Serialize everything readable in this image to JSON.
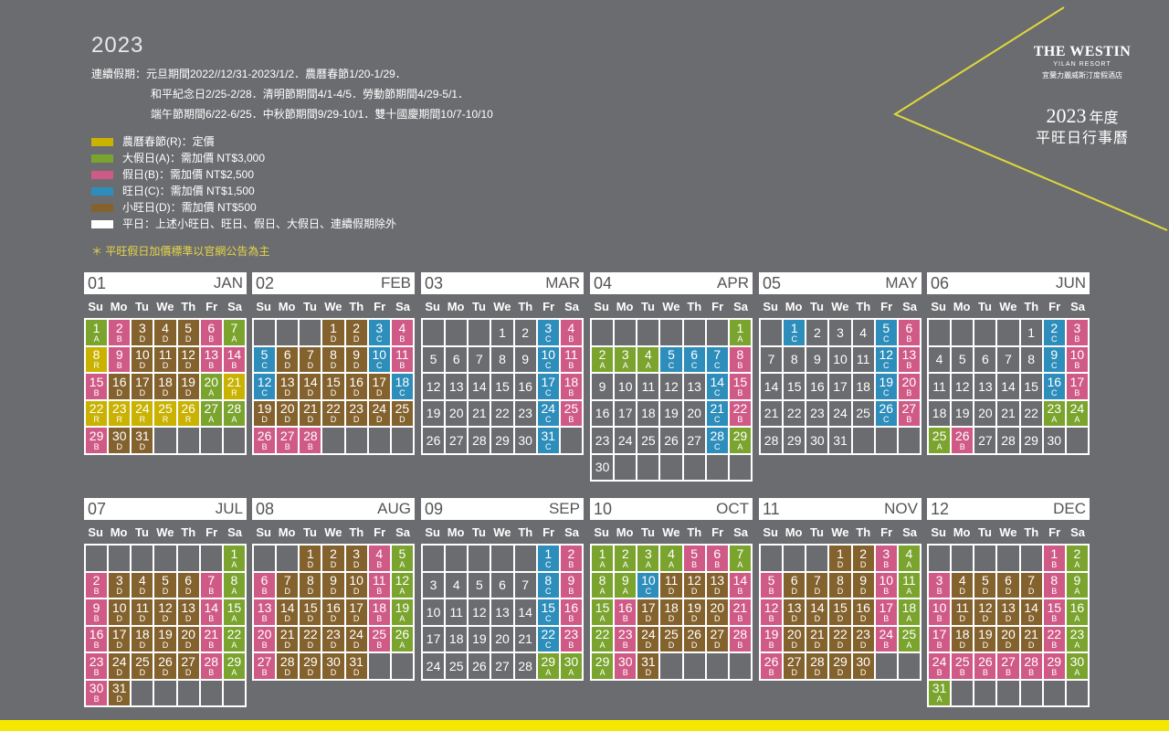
{
  "year": "2023",
  "holidays": [
    "連續假期：元旦期間2022//12/31-2023/1/2．農曆春節1/20-1/29．",
    "和平紀念日2/25-2/28．清明節期間4/1-4/5．勞動節期間4/29-5/1．",
    "端午節期間6/22-6/25．中秋節期間9/29-10/1．雙十國慶期間10/7-10/10"
  ],
  "legend": [
    {
      "color": "#c9b200",
      "text": "農曆春節(R)：定價"
    },
    {
      "color": "#7aa42e",
      "text": "大假日(A)：需加價 NT$3,000"
    },
    {
      "color": "#d05a86",
      "text": "假日(B)：需加價 NT$2,500"
    },
    {
      "color": "#2d8dbb",
      "text": "旺日(C)：需加價 NT$1,500"
    },
    {
      "color": "#84622e",
      "text": "小旺日(D)：需加價 NT$500"
    },
    {
      "color": "#ffffff",
      "text": "平日：上述小旺日、旺日、假日、大假日、連續假期除外"
    }
  ],
  "note": "＊ 平旺假日加價標準以官網公告為主",
  "brand": {
    "name": "THE WESTIN",
    "sub": "YILAN RESORT",
    "cn": "宜蘭力麗威斯汀度假酒店"
  },
  "title": {
    "year": "2023",
    "suffix": "年度",
    "sub": "平旺日行事曆"
  },
  "weekdays": [
    "Su",
    "Mo",
    "Tu",
    "We",
    "Th",
    "Fr",
    "Sa"
  ],
  "colors": {
    "R": "#c9b200",
    "A": "#7aa42e",
    "B": "#d05a86",
    "C": "#2d8dbb",
    "D": "#84622e"
  },
  "months": [
    {
      "num": "01",
      "name": "JAN",
      "start": 0,
      "days": 31,
      "codes": "ABDDDBARBDDDBBBDDDDARRRRRRAABDD"
    },
    {
      "num": "02",
      "name": "FEB",
      "start": 3,
      "days": 28,
      "codes": "DDCBCDDDDCBCDDDDDCDDDDDDDBBBA"
    },
    {
      "num": "03",
      "name": "MAR",
      "start": 3,
      "days": 31,
      "codes": "..CB.....CB.....CB.....CB.....C"
    },
    {
      "num": "04",
      "name": "APR",
      "start": 6,
      "days": 30,
      "codes": "AAAACCCB.....CB.....CB.....CA"
    },
    {
      "num": "05",
      "name": "MAY",
      "start": 1,
      "days": 31,
      "codes": "C...CB.....CB.....CB.....CB...."
    },
    {
      "num": "06",
      "name": "JUN",
      "start": 4,
      "days": 30,
      "codes": ".CB.....CB.....CB.....AAAB....B"
    },
    {
      "num": "07",
      "name": "JUL",
      "start": 6,
      "days": 31,
      "codes": "ABDDDDBABDDDDBABDDDDBABDDDDBABD"
    },
    {
      "num": "08",
      "name": "AUG",
      "start": 2,
      "days": 31,
      "codes": "DDDBABDDDDBABDDDDBABDDDDBABDDDD"
    },
    {
      "num": "09",
      "name": "SEP",
      "start": 5,
      "days": 30,
      "codes": "CB.....CB.....CB.....CB.....AA"
    },
    {
      "num": "10",
      "name": "OCT",
      "start": 0,
      "days": 31,
      "codes": "AAAABBAAACDDDBABDDDDBABDDDDBABDD"
    },
    {
      "num": "11",
      "name": "NOV",
      "start": 3,
      "days": 30,
      "codes": "DDBABDDDDBABDDDDBABDDDDBABDDDD"
    },
    {
      "num": "12",
      "name": "DEC",
      "start": 5,
      "days": 31,
      "codes": "BABDDDDBABDDDDBABDDDDBABBBBBBAA"
    }
  ]
}
